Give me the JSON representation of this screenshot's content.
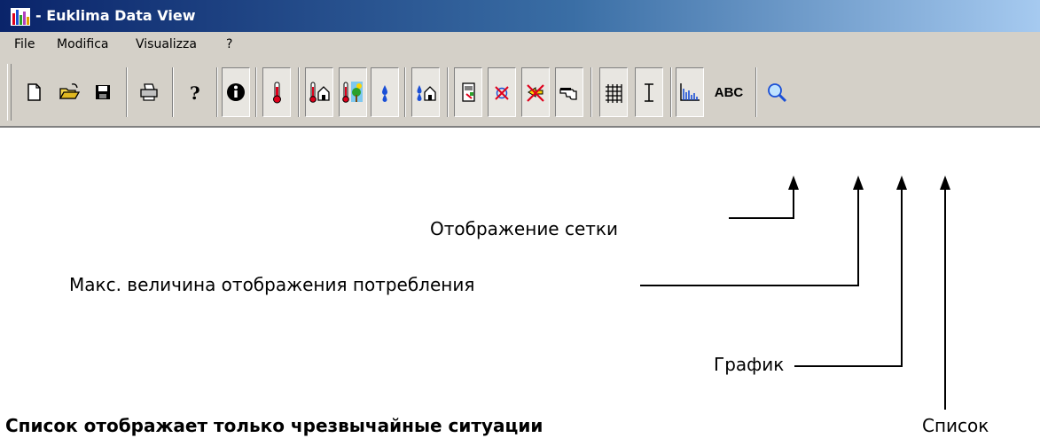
{
  "window": {
    "title": " - Euklima Data View"
  },
  "menu": {
    "items": [
      "File",
      "Modifica",
      "Visualizza",
      "?"
    ]
  },
  "toolbar": {
    "abc_label": "ABC"
  },
  "annotations": {
    "grid": "Отображение сетки",
    "max_consumption": "Макс. величина отображения потребления",
    "chart": "График",
    "emergency_list": "Список отображает только чрезвычайные ситуации",
    "list": "Список"
  },
  "colors": {
    "titlebar_start": "#0a246a",
    "titlebar_end": "#a6caf0",
    "toolbar_bg": "#d4d0c8",
    "icon_red": "#e0001b",
    "icon_blue": "#1a4fd6"
  }
}
